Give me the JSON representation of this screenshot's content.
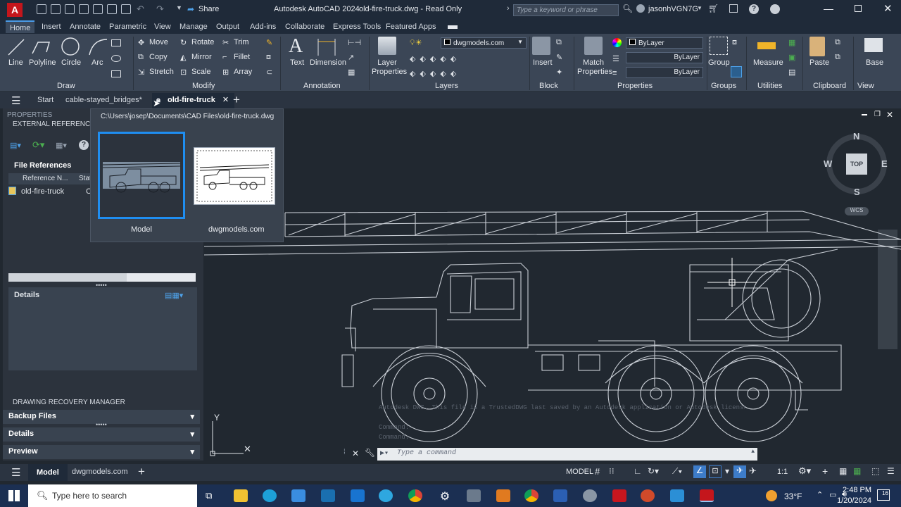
{
  "titlebar": {
    "app_title": "Autodesk AutoCAD 2024",
    "doc_title": "old-fire-truck.dwg - Read Only",
    "share": "Share",
    "search_placeholder": "Type a keyword or phrase",
    "user": "jasonhVGN7G"
  },
  "ribbon_tabs": [
    "Home",
    "Insert",
    "Annotate",
    "Parametric",
    "View",
    "Manage",
    "Output",
    "Add-ins",
    "Collaborate",
    "Express Tools",
    "Featured Apps"
  ],
  "ribbon": {
    "draw": {
      "line": "Line",
      "polyline": "Polyline",
      "circle": "Circle",
      "arc": "Arc",
      "title": "Draw"
    },
    "modify": {
      "move": "Move",
      "rotate": "Rotate",
      "trim": "Trim",
      "copy": "Copy",
      "mirror": "Mirror",
      "fillet": "Fillet",
      "stretch": "Stretch",
      "scale": "Scale",
      "array": "Array",
      "title": "Modify"
    },
    "annotation": {
      "text": "Text",
      "dimension": "Dimension",
      "title": "Annotation"
    },
    "layers": {
      "layer_properties": "Layer Properties",
      "layer_name": "dwgmodels.com",
      "title": "Layers"
    },
    "block": {
      "insert": "Insert",
      "title": "Block"
    },
    "properties": {
      "match": "Match Properties",
      "color": "ByLayer",
      "linetype": "ByLayer",
      "lineweight": "ByLayer",
      "title": "Properties"
    },
    "groups": {
      "group": "Group",
      "title": "Groups"
    },
    "utilities": {
      "measure": "Measure",
      "title": "Utilities"
    },
    "clipboard": {
      "paste": "Paste",
      "title": "Clipboard"
    },
    "view": {
      "base": "Base",
      "title": "View"
    }
  },
  "doc_tabs": {
    "start": "Start",
    "tab1": "cable-stayed_bridges*",
    "tab2": "old-fire-truck"
  },
  "popup": {
    "path": "C:\\Users\\josep\\Documents\\CAD Files\\old-fire-truck.dwg",
    "model_label": "Model",
    "layout_label": "dwgmodels.com"
  },
  "left_panel": {
    "properties": "PROPERTIES",
    "xref_title": "EXTERNAL REFERENCES",
    "file_refs": "File References",
    "col_ref": "Reference N...",
    "col_status": "Stat",
    "ref_item": "old-fire-truck",
    "ref_status": "C",
    "details": "Details",
    "recovery_title": "DRAWING RECOVERY MANAGER",
    "backup": "Backup Files",
    "details2": "Details",
    "preview": "Preview"
  },
  "viewcube": {
    "n": "N",
    "s": "S",
    "e": "E",
    "w": "W",
    "top": "TOP",
    "wcs": "WCS"
  },
  "command": {
    "placeholder": "Type a command",
    "history1": "Autodesk DWG. This file is a TrustedDWG last saved by an Autodesk application or Autodesk licensed application.",
    "history2": "Command:",
    "history3": "Command:"
  },
  "status": {
    "model_tab": "Model",
    "layout_tab": "dwgmodels.com",
    "model": "MODEL",
    "scale": "1:1"
  },
  "taskbar": {
    "search": "Type here to search",
    "temp": "33°F",
    "time": "2:48 PM",
    "date": "1/20/2024",
    "notif": "16"
  }
}
